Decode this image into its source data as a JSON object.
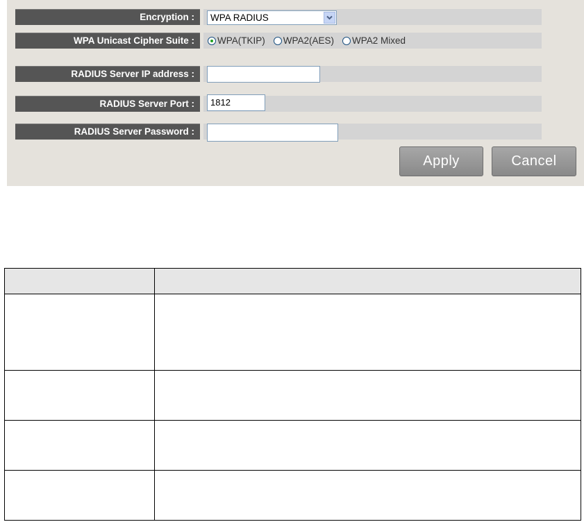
{
  "form": {
    "encryption": {
      "label": "Encryption :",
      "selected": "WPA RADIUS"
    },
    "cipher_suite": {
      "label": "WPA Unicast Cipher Suite :",
      "options": [
        "WPA(TKIP)",
        "WPA2(AES)",
        "WPA2 Mixed"
      ],
      "selected": "WPA(TKIP)"
    },
    "radius_ip": {
      "label": "RADIUS Server IP address :",
      "value": ""
    },
    "radius_port": {
      "label": "RADIUS Server Port :",
      "value": "1812"
    },
    "radius_password": {
      "label": "RADIUS Server Password :",
      "value": ""
    }
  },
  "buttons": {
    "apply": "Apply",
    "cancel": "Cancel"
  },
  "colors": {
    "panel_bg": "#e5e2dc",
    "label_bg": "#555555",
    "field_bg": "#d4d4d4",
    "radio_selected": "#21a121"
  },
  "icons": {
    "select_arrow": "chevron-down-icon",
    "radio": "radio-button-icon"
  },
  "table": {
    "header": [
      "",
      ""
    ],
    "rows": [
      [
        "",
        ""
      ],
      [
        "",
        ""
      ],
      [
        "",
        ""
      ],
      [
        "",
        ""
      ]
    ]
  }
}
